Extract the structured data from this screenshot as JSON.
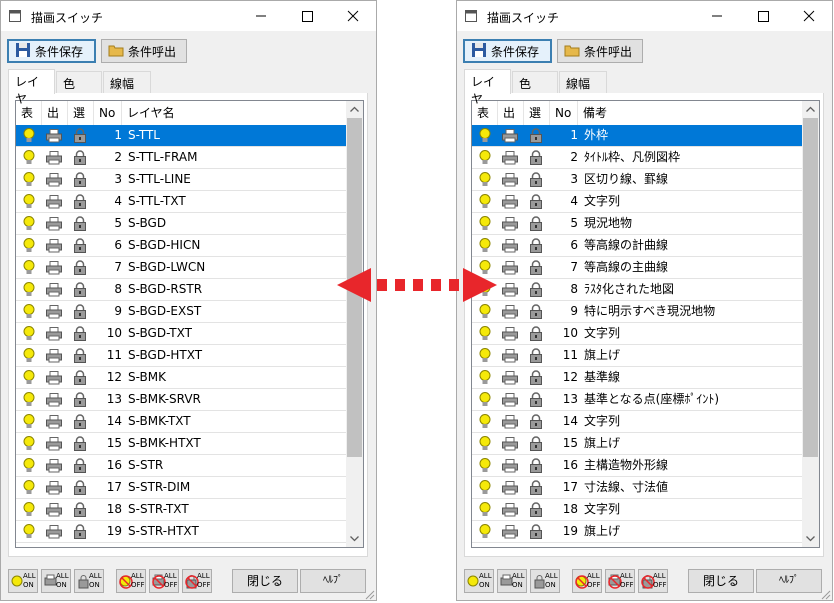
{
  "colors": {
    "accent": "#0078d7",
    "arrow": "#e8262b",
    "bulb": "#f5e90a",
    "window_bg": "#f0f0f0"
  },
  "left": {
    "title": "描画スイッチ",
    "toolbar": {
      "save_label": "条件保存",
      "load_label": "条件呼出"
    },
    "tabs": [
      "レイヤ",
      "色",
      "線幅"
    ],
    "columns": [
      "表",
      "出",
      "選",
      "No",
      "レイヤ名"
    ],
    "rows": [
      {
        "no": "1",
        "name": "S-TTL"
      },
      {
        "no": "2",
        "name": "S-TTL-FRAM"
      },
      {
        "no": "3",
        "name": "S-TTL-LINE"
      },
      {
        "no": "4",
        "name": "S-TTL-TXT"
      },
      {
        "no": "5",
        "name": "S-BGD"
      },
      {
        "no": "6",
        "name": "S-BGD-HICN"
      },
      {
        "no": "7",
        "name": "S-BGD-LWCN"
      },
      {
        "no": "8",
        "name": "S-BGD-RSTR"
      },
      {
        "no": "9",
        "name": "S-BGD-EXST"
      },
      {
        "no": "10",
        "name": "S-BGD-TXT"
      },
      {
        "no": "11",
        "name": "S-BGD-HTXT"
      },
      {
        "no": "12",
        "name": "S-BMK"
      },
      {
        "no": "13",
        "name": "S-BMK-SRVR"
      },
      {
        "no": "14",
        "name": "S-BMK-TXT"
      },
      {
        "no": "15",
        "name": "S-BMK-HTXT"
      },
      {
        "no": "16",
        "name": "S-STR"
      },
      {
        "no": "17",
        "name": "S-STR-DIM"
      },
      {
        "no": "18",
        "name": "S-STR-TXT"
      },
      {
        "no": "19",
        "name": "S-STR-HTXT"
      }
    ],
    "bottom": {
      "all_label": "ALL",
      "on_label": "ON",
      "off_label": "OFF",
      "close_label": "閉じる",
      "help_label": "ﾍﾙﾌﾟ"
    }
  },
  "right": {
    "title": "描画スイッチ",
    "toolbar": {
      "save_label": "条件保存",
      "load_label": "条件呼出"
    },
    "tabs": [
      "レイヤ",
      "色",
      "線幅"
    ],
    "columns": [
      "表",
      "出",
      "選",
      "No",
      "備考"
    ],
    "rows": [
      {
        "no": "1",
        "name": "外枠"
      },
      {
        "no": "2",
        "name": "ﾀｲﾄﾙ枠、凡例図枠"
      },
      {
        "no": "3",
        "name": "区切り線、罫線"
      },
      {
        "no": "4",
        "name": "文字列"
      },
      {
        "no": "5",
        "name": "現況地物"
      },
      {
        "no": "6",
        "name": "等高線の計曲線"
      },
      {
        "no": "7",
        "name": "等高線の主曲線"
      },
      {
        "no": "8",
        "name": "ﾗｽﾀ化された地図"
      },
      {
        "no": "9",
        "name": "特に明示すべき現況地物"
      },
      {
        "no": "10",
        "name": "文字列"
      },
      {
        "no": "11",
        "name": "旗上げ"
      },
      {
        "no": "12",
        "name": "基準線"
      },
      {
        "no": "13",
        "name": "基準となる点(座標ﾎﾟｲﾝﾄ)"
      },
      {
        "no": "14",
        "name": "文字列"
      },
      {
        "no": "15",
        "name": "旗上げ"
      },
      {
        "no": "16",
        "name": "主構造物外形線"
      },
      {
        "no": "17",
        "name": "寸法線、寸法値"
      },
      {
        "no": "18",
        "name": "文字列"
      },
      {
        "no": "19",
        "name": "旗上げ"
      }
    ],
    "bottom": {
      "all_label": "ALL",
      "on_label": "ON",
      "off_label": "OFF",
      "close_label": "閉じる",
      "help_label": "ﾍﾙﾌﾟ"
    }
  }
}
